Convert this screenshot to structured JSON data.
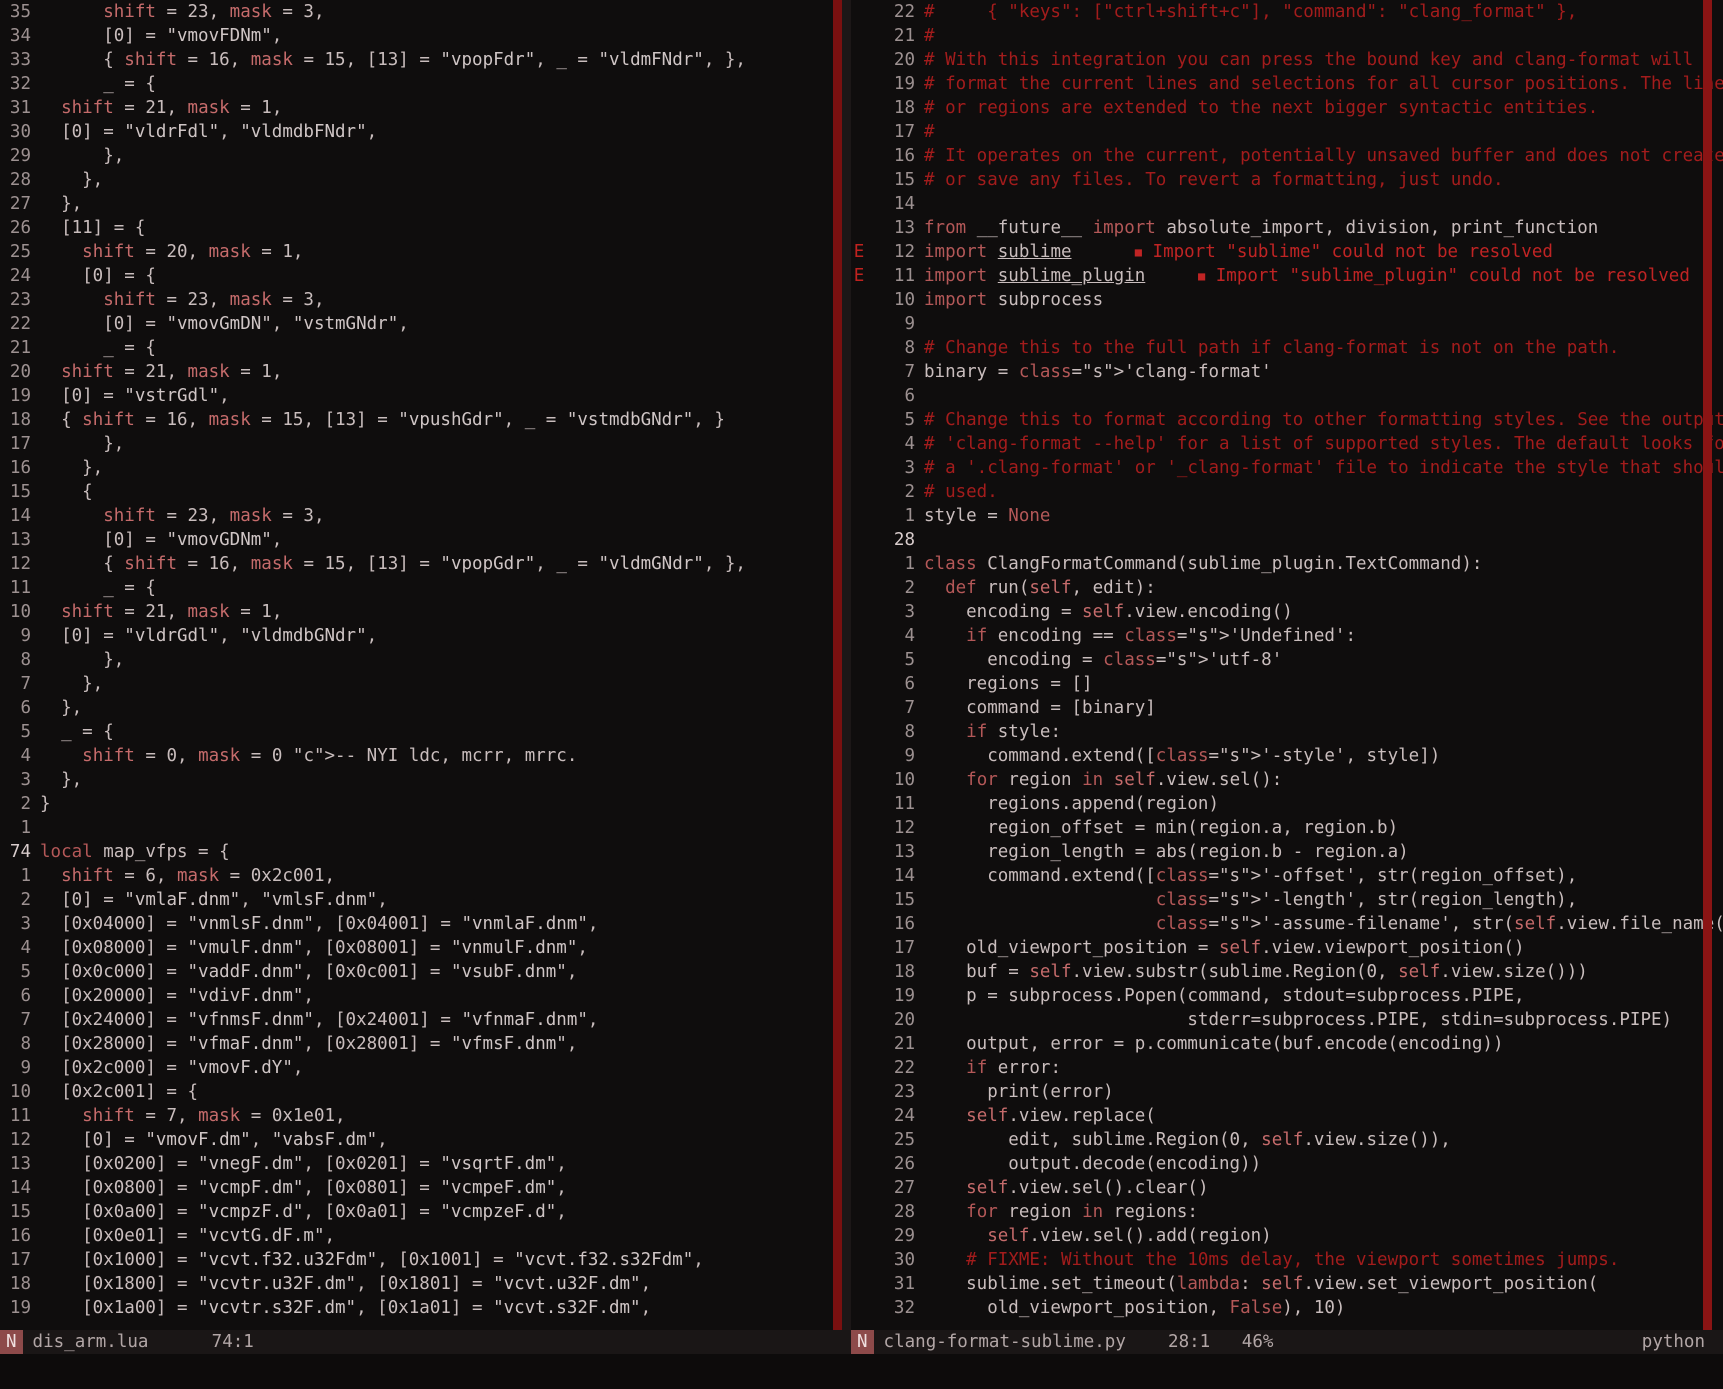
{
  "left": {
    "filename": "dis_arm.lua",
    "position": "74:1",
    "mode": "N",
    "lines": [
      {
        "n": "35",
        "t": "      shift = 23, mask = 3,"
      },
      {
        "n": "34",
        "t": "      [0] = \"vmovFDNm\","
      },
      {
        "n": "33",
        "t": "      { shift = 16, mask = 15, [13] = \"vpopFdr\", _ = \"vldmFNdr\", },"
      },
      {
        "n": "32",
        "t": "      _ = {"
      },
      {
        "n": "31",
        "t": "  shift = 21, mask = 1,"
      },
      {
        "n": "30",
        "t": "  [0] = \"vldrFdl\", \"vldmdbFNdr\","
      },
      {
        "n": "29",
        "t": "      },"
      },
      {
        "n": "28",
        "t": "    },"
      },
      {
        "n": "27",
        "t": "  },"
      },
      {
        "n": "26",
        "t": "  [11] = {"
      },
      {
        "n": "25",
        "t": "    shift = 20, mask = 1,"
      },
      {
        "n": "24",
        "t": "    [0] = {"
      },
      {
        "n": "23",
        "t": "      shift = 23, mask = 3,"
      },
      {
        "n": "22",
        "t": "      [0] = \"vmovGmDN\", \"vstmGNdr\","
      },
      {
        "n": "21",
        "t": "      _ = {"
      },
      {
        "n": "20",
        "t": "  shift = 21, mask = 1,"
      },
      {
        "n": "19",
        "t": "  [0] = \"vstrGdl\","
      },
      {
        "n": "18",
        "t": "  { shift = 16, mask = 15, [13] = \"vpushGdr\", _ = \"vstmdbGNdr\", }"
      },
      {
        "n": "17",
        "t": "      },"
      },
      {
        "n": "16",
        "t": "    },"
      },
      {
        "n": "15",
        "t": "    {"
      },
      {
        "n": "14",
        "t": "      shift = 23, mask = 3,"
      },
      {
        "n": "13",
        "t": "      [0] = \"vmovGDNm\","
      },
      {
        "n": "12",
        "t": "      { shift = 16, mask = 15, [13] = \"vpopGdr\", _ = \"vldmGNdr\", },"
      },
      {
        "n": "11",
        "t": "      _ = {"
      },
      {
        "n": "10",
        "t": "  shift = 21, mask = 1,"
      },
      {
        "n": "9",
        "t": "  [0] = \"vldrGdl\", \"vldmdbGNdr\","
      },
      {
        "n": "8",
        "t": "      },"
      },
      {
        "n": "7",
        "t": "    },"
      },
      {
        "n": "6",
        "t": "  },"
      },
      {
        "n": "5",
        "t": "  _ = {"
      },
      {
        "n": "4",
        "t": "    shift = 0, mask = 0 -- NYI ldc, mcrr, mrrc."
      },
      {
        "n": "3",
        "t": "  },"
      },
      {
        "n": "2",
        "t": "}"
      },
      {
        "n": "1",
        "t": ""
      },
      {
        "n": "74",
        "t": "local map_vfps = {",
        "cur": true
      },
      {
        "n": "1",
        "t": "  shift = 6, mask = 0x2c001,"
      },
      {
        "n": "2",
        "t": "  [0] = \"vmlaF.dnm\", \"vmlsF.dnm\","
      },
      {
        "n": "3",
        "t": "  [0x04000] = \"vnmlsF.dnm\", [0x04001] = \"vnmlaF.dnm\","
      },
      {
        "n": "4",
        "t": "  [0x08000] = \"vmulF.dnm\", [0x08001] = \"vnmulF.dnm\","
      },
      {
        "n": "5",
        "t": "  [0x0c000] = \"vaddF.dnm\", [0x0c001] = \"vsubF.dnm\","
      },
      {
        "n": "6",
        "t": "  [0x20000] = \"vdivF.dnm\","
      },
      {
        "n": "7",
        "t": "  [0x24000] = \"vfnmsF.dnm\", [0x24001] = \"vfnmaF.dnm\","
      },
      {
        "n": "8",
        "t": "  [0x28000] = \"vfmaF.dnm\", [0x28001] = \"vfmsF.dnm\","
      },
      {
        "n": "9",
        "t": "  [0x2c000] = \"vmovF.dY\","
      },
      {
        "n": "10",
        "t": "  [0x2c001] = {"
      },
      {
        "n": "11",
        "t": "    shift = 7, mask = 0x1e01,"
      },
      {
        "n": "12",
        "t": "    [0] = \"vmovF.dm\", \"vabsF.dm\","
      },
      {
        "n": "13",
        "t": "    [0x0200] = \"vnegF.dm\", [0x0201] = \"vsqrtF.dm\","
      },
      {
        "n": "14",
        "t": "    [0x0800] = \"vcmpF.dm\", [0x0801] = \"vcmpeF.dm\","
      },
      {
        "n": "15",
        "t": "    [0x0a00] = \"vcmpzF.d\", [0x0a01] = \"vcmpzeF.d\","
      },
      {
        "n": "16",
        "t": "    [0x0e01] = \"vcvtG.dF.m\","
      },
      {
        "n": "17",
        "t": "    [0x1000] = \"vcvt.f32.u32Fdm\", [0x1001] = \"vcvt.f32.s32Fdm\","
      },
      {
        "n": "18",
        "t": "    [0x1800] = \"vcvtr.u32F.dm\", [0x1801] = \"vcvt.u32F.dm\","
      },
      {
        "n": "19",
        "t": "    [0x1a00] = \"vcvtr.s32F.dm\", [0x1a01] = \"vcvt.s32F.dm\","
      }
    ]
  },
  "right": {
    "filename": "clang-format-sublime.py",
    "position": "28:1",
    "percent": "46%",
    "filetype": "python",
    "mode": "N",
    "lines": [
      {
        "n": "22",
        "t": "#     { \"keys\": [\"ctrl+shift+c\"], \"command\": \"clang_format\" },",
        "c": true
      },
      {
        "n": "21",
        "t": "#",
        "c": true
      },
      {
        "n": "20",
        "t": "# With this integration you can press the bound key and clang-format will",
        "c": true
      },
      {
        "n": "19",
        "t": "# format the current lines and selections for all cursor positions. The lines",
        "c": true
      },
      {
        "n": "18",
        "t": "# or regions are extended to the next bigger syntactic entities.",
        "c": true
      },
      {
        "n": "17",
        "t": "#",
        "c": true
      },
      {
        "n": "16",
        "t": "# It operates on the current, potentially unsaved buffer and does not create",
        "c": true
      },
      {
        "n": "15",
        "t": "# or save any files. To revert a formatting, just undo.",
        "c": true
      },
      {
        "n": "14",
        "t": ""
      },
      {
        "n": "13",
        "t": "from __future__ import absolute_import, division, print_function"
      },
      {
        "n": "12",
        "sign": "E",
        "t": "import sublime",
        "err": "Import \"sublime\" could not be resolved",
        "errpad": "      "
      },
      {
        "n": "11",
        "sign": "E",
        "t": "import sublime_plugin",
        "err": "Import \"sublime_plugin\" could not be resolved",
        "errpad": "     "
      },
      {
        "n": "10",
        "t": "import subprocess"
      },
      {
        "n": "9",
        "t": ""
      },
      {
        "n": "8",
        "t": "# Change this to the full path if clang-format is not on the path.",
        "c": true
      },
      {
        "n": "7",
        "t": "binary = 'clang-format'"
      },
      {
        "n": "6",
        "t": ""
      },
      {
        "n": "5",
        "t": "# Change this to format according to other formatting styles. See the output of",
        "c": true
      },
      {
        "n": "4",
        "t": "# 'clang-format --help' for a list of supported styles. The default looks for",
        "c": true
      },
      {
        "n": "3",
        "t": "# a '.clang-format' or '_clang-format' file to indicate the style that should b",
        "c": true
      },
      {
        "n": "2",
        "t": "# used.",
        "c": true
      },
      {
        "n": "1",
        "t": "style = None"
      },
      {
        "n": "28",
        "t": "",
        "cur": true
      },
      {
        "n": "1",
        "t": "class ClangFormatCommand(sublime_plugin.TextCommand):"
      },
      {
        "n": "2",
        "t": "  def run(self, edit):"
      },
      {
        "n": "3",
        "t": "    encoding = self.view.encoding()"
      },
      {
        "n": "4",
        "t": "    if encoding == 'Undefined':"
      },
      {
        "n": "5",
        "t": "      encoding = 'utf-8'"
      },
      {
        "n": "6",
        "t": "    regions = []"
      },
      {
        "n": "7",
        "t": "    command = [binary]"
      },
      {
        "n": "8",
        "t": "    if style:"
      },
      {
        "n": "9",
        "t": "      command.extend(['-style', style])"
      },
      {
        "n": "10",
        "t": "    for region in self.view.sel():"
      },
      {
        "n": "11",
        "t": "      regions.append(region)"
      },
      {
        "n": "12",
        "t": "      region_offset = min(region.a, region.b)"
      },
      {
        "n": "13",
        "t": "      region_length = abs(region.b - region.a)"
      },
      {
        "n": "14",
        "t": "      command.extend(['-offset', str(region_offset),"
      },
      {
        "n": "15",
        "t": "                      '-length', str(region_length),"
      },
      {
        "n": "16",
        "t": "                      '-assume-filename', str(self.view.file_name())])"
      },
      {
        "n": "17",
        "t": "    old_viewport_position = self.view.viewport_position()"
      },
      {
        "n": "18",
        "t": "    buf = self.view.substr(sublime.Region(0, self.view.size()))"
      },
      {
        "n": "19",
        "t": "    p = subprocess.Popen(command, stdout=subprocess.PIPE,"
      },
      {
        "n": "20",
        "t": "                         stderr=subprocess.PIPE, stdin=subprocess.PIPE)"
      },
      {
        "n": "21",
        "t": "    output, error = p.communicate(buf.encode(encoding))"
      },
      {
        "n": "22",
        "t": "    if error:"
      },
      {
        "n": "23",
        "t": "      print(error)"
      },
      {
        "n": "24",
        "t": "    self.view.replace("
      },
      {
        "n": "25",
        "t": "        edit, sublime.Region(0, self.view.size()),"
      },
      {
        "n": "26",
        "t": "        output.decode(encoding))"
      },
      {
        "n": "27",
        "t": "    self.view.sel().clear()"
      },
      {
        "n": "28",
        "t": "    for region in regions:"
      },
      {
        "n": "29",
        "t": "      self.view.sel().add(region)"
      },
      {
        "n": "30",
        "t": "    # FIXME: Without the 10ms delay, the viewport sometimes jumps.",
        "c": true
      },
      {
        "n": "31",
        "t": "    sublime.set_timeout(lambda: self.view.set_viewport_position("
      },
      {
        "n": "32",
        "t": "      old_viewport_position, False), 10)"
      }
    ]
  },
  "colors": {
    "accent": "#7a1010",
    "error": "#c02424",
    "comment": "#a31c1c"
  }
}
